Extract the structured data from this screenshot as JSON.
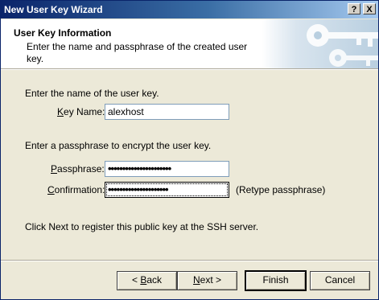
{
  "window": {
    "title": "New User Key Wizard",
    "help_button": "?",
    "close_button": "X"
  },
  "header": {
    "title": "User Key Information",
    "subtitle": "Enter the name and passphrase of the created user key."
  },
  "name_section": {
    "instruction": "Enter the name of the user key.",
    "key_name_label_accel": "K",
    "key_name_label_rest": "ey Name:",
    "key_name_value": "alexhost"
  },
  "passphrase_section": {
    "instruction": "Enter a passphrase to encrypt the user key.",
    "passphrase_label_accel": "P",
    "passphrase_label_rest": "assphrase:",
    "passphrase_value": "••••••••••••••••••••••",
    "confirmation_label_accel": "C",
    "confirmation_label_rest": "onfirmation:",
    "confirmation_value": "•••••••••••••••••••••",
    "retype_hint": "(Retype passphrase)"
  },
  "info_text": "Click Next to register this public key at the SSH server.",
  "buttons": {
    "back_prefix": "< ",
    "back_accel": "B",
    "back_rest": "ack",
    "next_accel": "N",
    "next_rest": "ext >",
    "finish": "Finish",
    "cancel": "Cancel"
  },
  "colors": {
    "title_bar": "#0a246a",
    "dialog_bg": "#ece9d8",
    "header_bg": "#ffffff"
  }
}
